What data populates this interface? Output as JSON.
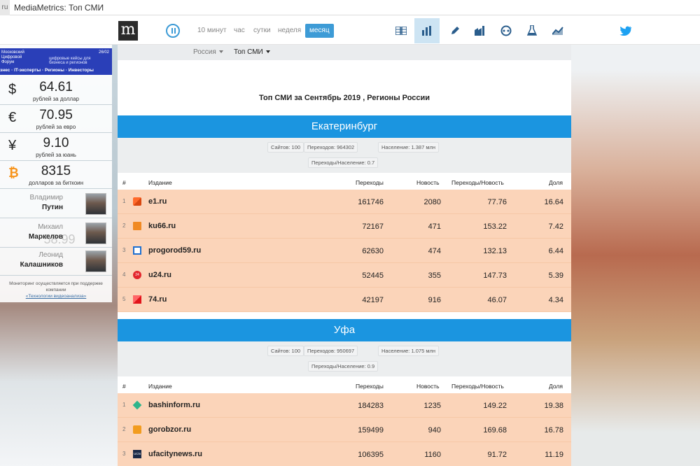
{
  "browser": {
    "favicon_text": "ru",
    "title": "MediaMetrics: Топ СМИ"
  },
  "nav": {
    "logo": "m",
    "periods": [
      "10 минут",
      "час",
      "сутки",
      "неделя",
      "месяц"
    ],
    "active_period": "месяц",
    "icons": [
      "table-icon",
      "bar-chart-icon",
      "pen-icon",
      "factory-icon",
      "soccer-ball-icon",
      "flask-icon",
      "trend-line-icon",
      "twitter-icon"
    ]
  },
  "sidebar": {
    "banner": {
      "title": "Московский Цифровой Форум",
      "date": "26/02",
      "subtitle": "цифровые кейсы для бизнеса и регионов",
      "tagline": "знес · IT-эксперты · Регионы · Инвесторы"
    },
    "rates": [
      {
        "symbol": "$",
        "value": "64.61",
        "label": "рублей за доллар"
      },
      {
        "symbol": "€",
        "value": "70.95",
        "label": "рублей за евро"
      },
      {
        "symbol": "¥",
        "value": "9.10",
        "label": "рублей за юань"
      },
      {
        "symbol": "₿",
        "value": "8315",
        "label": "долларов за биткоин"
      }
    ],
    "ghost_value": "58.99",
    "people": [
      {
        "first": "Владимир",
        "last": "Путин"
      },
      {
        "first": "Михаил",
        "last": "Маркелов"
      },
      {
        "first": "Леонид",
        "last": "Калашников"
      }
    ],
    "credit_text": "Мониторинг осуществляется при поддержке компании",
    "credit_link": "«Технологии видеоанализа»"
  },
  "main": {
    "crumbs": {
      "country": "Россия",
      "section": "Топ СМИ"
    },
    "title": "Топ СМИ за Сентябрь 2019 , Регионы России",
    "columns": {
      "num": "#",
      "name": "Издание",
      "visits": "Переходы",
      "news": "Новость",
      "ratio": "Переходы/Новость",
      "share": "Доля"
    },
    "cities": [
      {
        "name": "Екатеринбург",
        "sites": "Сайтов: 100",
        "visits": "Переходов: 964302",
        "population": "Население: 1.387 млн",
        "ratio": "Переходы/Население: 0.7",
        "rows": [
          {
            "n": "1",
            "name": "e1.ru",
            "visits": "161746",
            "news": "2080",
            "ratio": "77.76",
            "share": "16.64",
            "fav": "fav-e1",
            "favtxt": ""
          },
          {
            "n": "2",
            "name": "ku66.ru",
            "visits": "72167",
            "news": "471",
            "ratio": "153.22",
            "share": "7.42",
            "fav": "fav-ku",
            "favtxt": ""
          },
          {
            "n": "3",
            "name": "progorod59.ru",
            "visits": "62630",
            "news": "474",
            "ratio": "132.13",
            "share": "6.44",
            "fav": "fav-pg",
            "favtxt": ""
          },
          {
            "n": "4",
            "name": "u24.ru",
            "visits": "52445",
            "news": "355",
            "ratio": "147.73",
            "share": "5.39",
            "fav": "fav-u24",
            "favtxt": "24"
          },
          {
            "n": "5",
            "name": "74.ru",
            "visits": "42197",
            "news": "916",
            "ratio": "46.07",
            "share": "4.34",
            "fav": "fav-74",
            "favtxt": ""
          }
        ]
      },
      {
        "name": "Уфа",
        "sites": "Сайтов: 100",
        "visits": "Переходов: 950697",
        "population": "Население: 1.075 млн",
        "ratio": "Переходы/Население: 0.9",
        "rows": [
          {
            "n": "1",
            "name": "bashinform.ru",
            "visits": "184283",
            "news": "1235",
            "ratio": "149.22",
            "share": "19.38",
            "fav": "fav-bi",
            "favtxt": ""
          },
          {
            "n": "2",
            "name": "gorobzor.ru",
            "visits": "159499",
            "news": "940",
            "ratio": "169.68",
            "share": "16.78",
            "fav": "fav-gz",
            "favtxt": ""
          },
          {
            "n": "3",
            "name": "ufacitynews.ru",
            "visits": "106395",
            "news": "1160",
            "ratio": "91.72",
            "share": "11.19",
            "fav": "fav-ucn",
            "favtxt": "UCN"
          }
        ]
      }
    ]
  }
}
